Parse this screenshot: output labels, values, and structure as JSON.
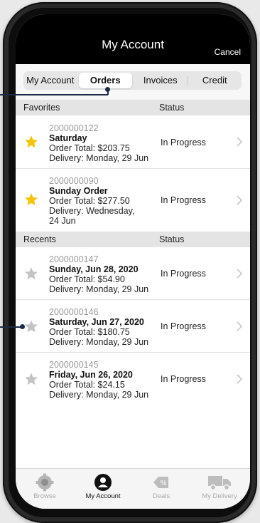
{
  "nav": {
    "title": "My Account",
    "cancel_label": "Cancel"
  },
  "segments": [
    {
      "label": "My Account",
      "active": false
    },
    {
      "label": "Orders",
      "active": true
    },
    {
      "label": "Invoices",
      "active": false
    },
    {
      "label": "Credit",
      "active": false
    }
  ],
  "favorites": {
    "header": "Favorites",
    "status_header": "Status",
    "rows": [
      {
        "order_no": "2000000122",
        "name": "Saturday",
        "total": "Order Total: $203.75",
        "delivery": [
          "Delivery: Monday, 29 Jun"
        ],
        "status": "In Progress",
        "starred": true
      },
      {
        "order_no": "2000000090",
        "name": "Sunday Order",
        "total": "Order Total: $277.50",
        "delivery": [
          "Delivery: Wednesday,",
          "24 Jun"
        ],
        "status": "In Progress",
        "starred": true
      }
    ]
  },
  "recents": {
    "header": "Recents",
    "status_header": "Status",
    "rows": [
      {
        "order_no": "2000000147",
        "name": "Sunday, Jun 28, 2020",
        "total": "Order Total: $54.90",
        "delivery": [
          "Delivery: Monday, 29 Jun"
        ],
        "status": "In Progress",
        "starred": false
      },
      {
        "order_no": "2000000146",
        "name": "Saturday, Jun 27, 2020",
        "total": "Order Total: $180.75",
        "delivery": [
          "Delivery: Monday, 29 Jun"
        ],
        "status": "In Progress",
        "starred": false
      },
      {
        "order_no": "2000000145",
        "name": "Friday, Jun 26, 2020",
        "total": "Order Total: $24.15",
        "delivery": [
          "Delivery: Monday, 29 Jun"
        ],
        "status": "In Progress",
        "starred": false
      }
    ]
  },
  "tabs": [
    {
      "label": "Browse",
      "icon": "gear-icon",
      "active": false
    },
    {
      "label": "My Account",
      "icon": "account-icon",
      "active": true
    },
    {
      "label": "Deals",
      "icon": "deals-icon",
      "active": false
    },
    {
      "label": "My Delivery",
      "icon": "truck-icon",
      "active": false
    }
  ],
  "colors": {
    "nav_bg": "#000000",
    "star_active": "#f5c400",
    "star_inactive": "#c4c4c4",
    "callout": "#1c2a44"
  }
}
